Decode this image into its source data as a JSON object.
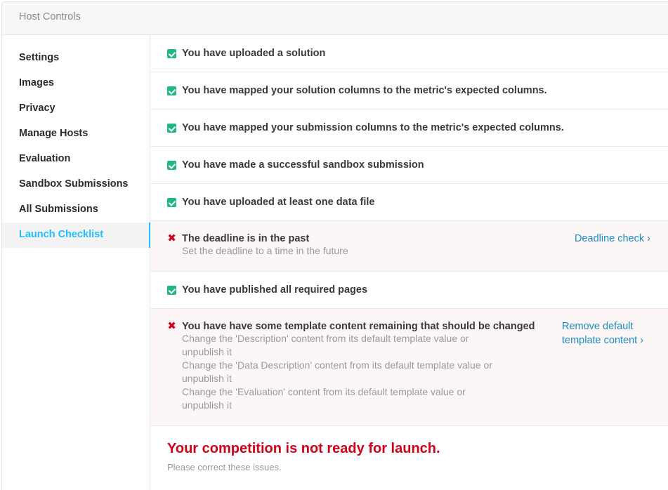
{
  "header": {
    "title": "Host Controls"
  },
  "sidebar": {
    "items": [
      {
        "label": "Settings"
      },
      {
        "label": "Images"
      },
      {
        "label": "Privacy"
      },
      {
        "label": "Manage Hosts"
      },
      {
        "label": "Evaluation"
      },
      {
        "label": "Sandbox Submissions"
      },
      {
        "label": "All Submissions"
      },
      {
        "label": "Launch Checklist"
      }
    ]
  },
  "checklist": {
    "uploaded_solution": "You have uploaded a solution",
    "mapped_solution": "You have mapped your solution columns to the metric's expected columns.",
    "mapped_submission": "You have mapped your submission columns to the metric's expected columns.",
    "sandbox_submission": "You have made a successful sandbox submission",
    "data_file": "You have uploaded at least one data file",
    "deadline": {
      "title": "The deadline is in the past",
      "detail": "Set the deadline to a time in the future",
      "link": "Deadline check ›"
    },
    "published_pages": "You have published all required pages",
    "template": {
      "title": "You have have some template content remaining that should be changed",
      "detail_1a": "Change the 'Description' content from its default template value or",
      "detail_1b": "unpublish it",
      "detail_2a": "Change the 'Data Description' content from its default template value or",
      "detail_2b": "unpublish it",
      "detail_3a": "Change the 'Evaluation' content from its default template value or",
      "detail_3b": "unpublish it",
      "link_1": "Remove default",
      "link_2": "template content ›"
    }
  },
  "footer": {
    "title": "Your competition is not ready for launch.",
    "subtitle": "Please correct these issues."
  },
  "colors": {
    "accent": "#20beff",
    "success": "#20b788",
    "error": "#d0021b",
    "link": "#1b8bc5"
  }
}
